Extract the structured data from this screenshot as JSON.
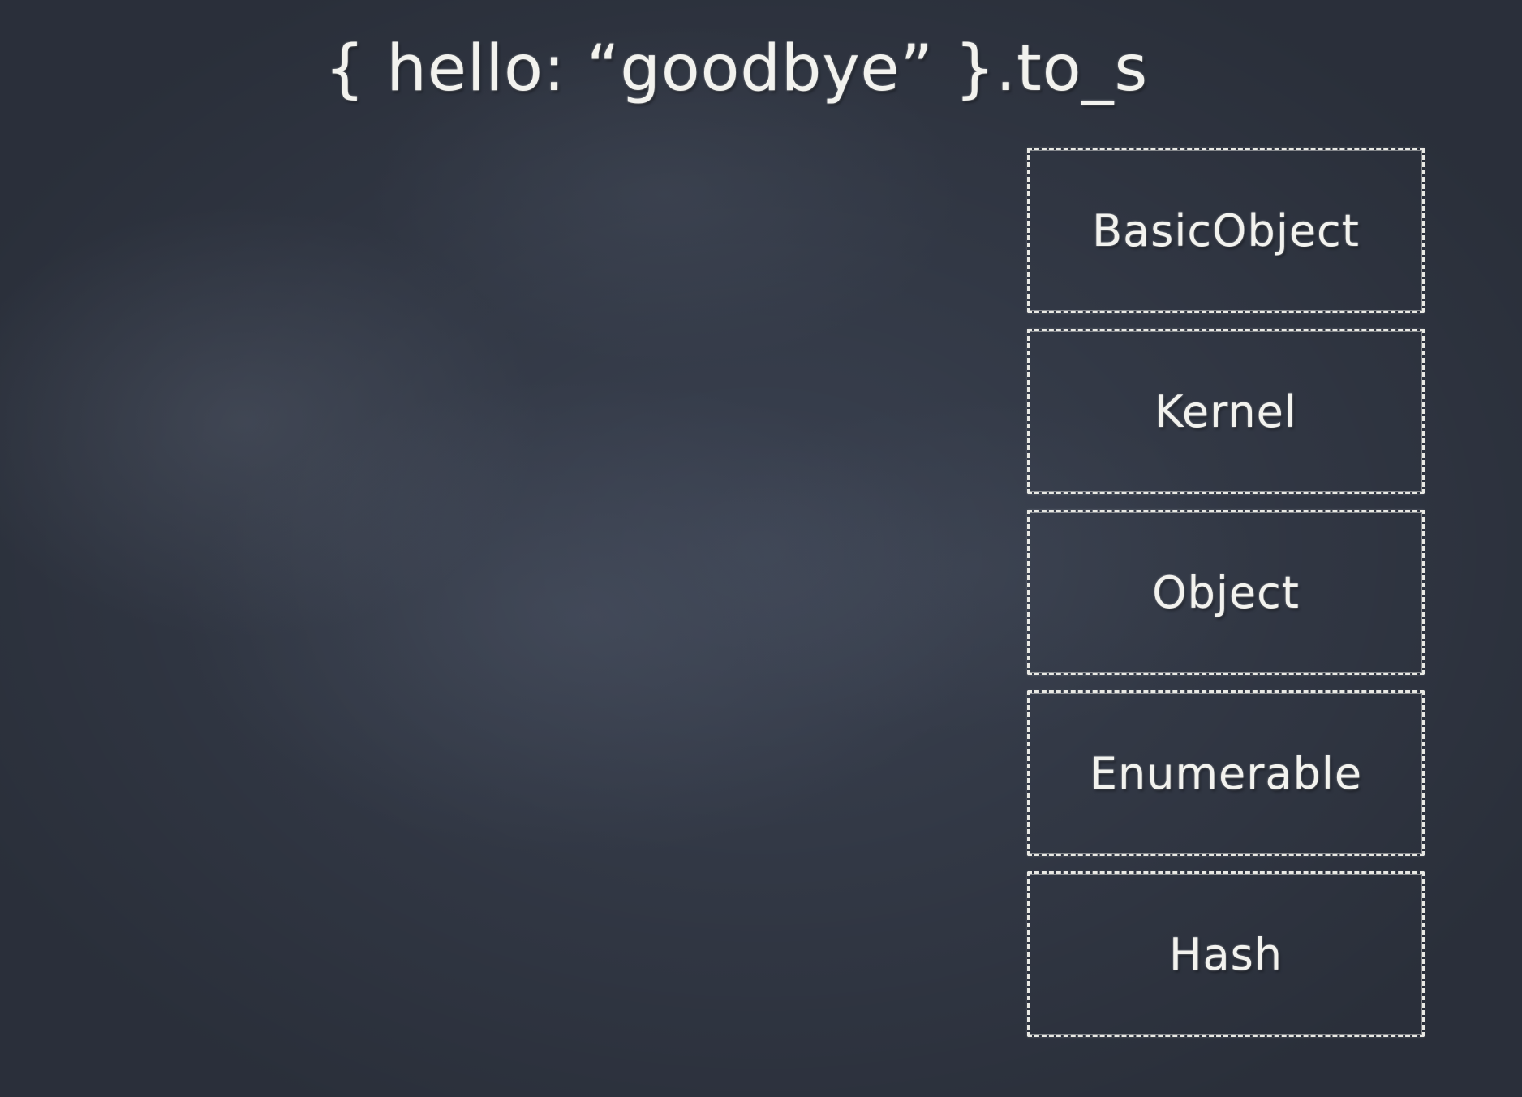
{
  "slide": {
    "title": "{ hello: “goodbye” }.to_s"
  },
  "ancestor_stack": {
    "items": [
      {
        "label": "BasicObject"
      },
      {
        "label": "Kernel"
      },
      {
        "label": "Object"
      },
      {
        "label": "Enumerable"
      },
      {
        "label": "Hash"
      }
    ]
  },
  "colors": {
    "chalkboard": "#3a4150",
    "chalk": "#f2f2ee"
  }
}
